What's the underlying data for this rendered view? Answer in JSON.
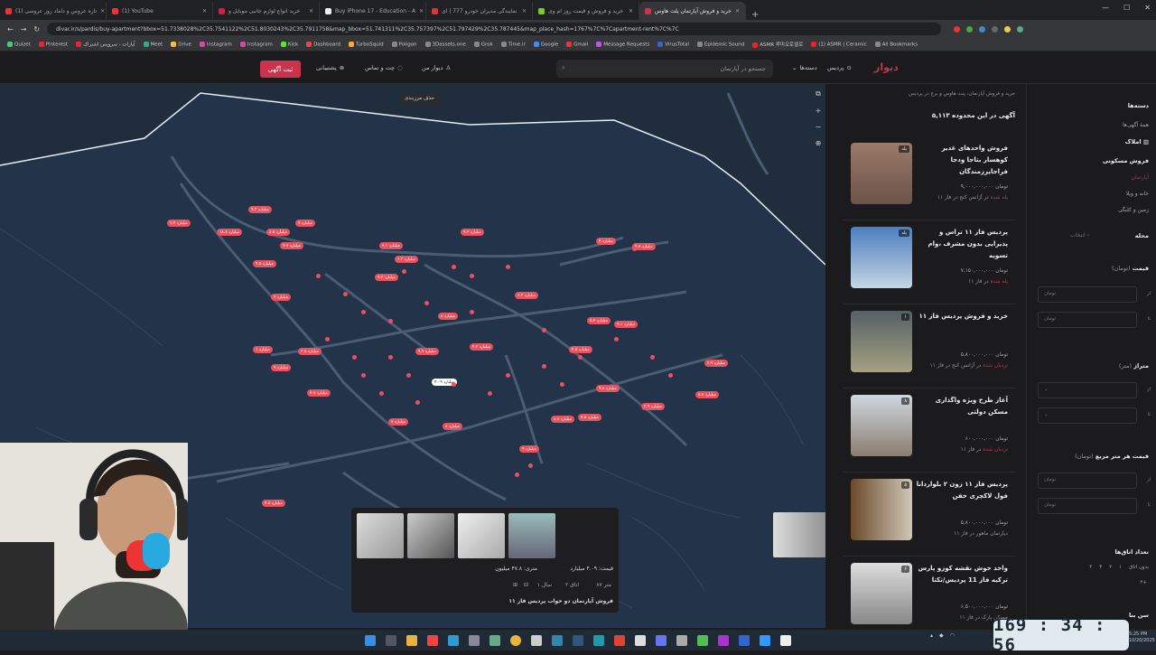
{
  "browser": {
    "tabs": [
      {
        "label": "(1) تاره عروس و داماد روز عروسی"
      },
      {
        "label": "(1) YouTube"
      },
      {
        "label": "خرید انواع لوازم جانبی موبایل و"
      },
      {
        "label": "Buy iPhone 17 - Education - A"
      },
      {
        "label": "نمایندگی مدیران خودرو 777 | ای"
      },
      {
        "label": "خرید و فروش و قیمت روز ام وی"
      },
      {
        "label": "خرید و فروش آپارتمان پلت هاوس"
      }
    ],
    "url": "divar.ir/s/pardis/buy-apartment?bbox=51.7338028%2C35.7541122%2C51.8030243%2C35.7911758&map_bbox=51.741311%2C35.757397%2C51.797429%2C35.787445&map_place_hash=1767%7C%7Capartment-rent%7C%7C",
    "bookmarks": [
      "Quizet",
      "Pinterest",
      "آپارات - سرویس اشتراک",
      "Meet",
      "Drive",
      "Instagram",
      "Instagram",
      "Kick",
      "Dashboard",
      "TurboSquid",
      "Poligon",
      "3Dassets.one",
      "Grok",
      "Time.ir",
      "Google",
      "Gmail",
      "Message Requests",
      "VirusTotal",
      "Epidemic Sound",
      "ASMR 루미오로셀로",
      "(1) ASMR | Ceramic",
      "All Bookmarks"
    ]
  },
  "header": {
    "logo": "دیوار",
    "city": "پردیس",
    "categories": "دسته‌ها",
    "search_placeholder": "جستجو در آپارتمان",
    "my_divar": "دیوار من",
    "chat": "چت و تماس",
    "support": "پشتیبانی",
    "post_button": "ثبت آگهی"
  },
  "map": {
    "tooltip": "حذف مرزبندی",
    "zoom_in": "+",
    "zoom_out": "−",
    "pins": [
      "۹.۴ میلیارد",
      "۱۸.۸ میلیارد",
      "۹.۳ میلیارد",
      "۷ میلیارد",
      "۸.۵ میلیارد",
      "۹.۷ میلیارد",
      "۹.۵ میلیارد",
      "۶.۱ میلیارد",
      "۶.۳ میلیارد",
      "۹.۲ میلیارد",
      "۴ میلیارد",
      "۴.۷ میلیارد",
      "۷ میلیارد",
      "۹.۴ میلیارد",
      "۶.۲ میلیارد",
      "۱ میلیارد",
      "۹ میلیارد",
      "۳.۸ میلیارد",
      "۴.۷ میلیارد",
      "۹.۹ میلیارد",
      "۸ میلیارد",
      "۴.۲ میلیارد",
      "۵.۴ میلیارد",
      "۴.۵ میلیارد",
      "۹.۱ میلیارد",
      "۲.۹ میلیارد",
      "۵.۷ میلیارد",
      "۶.۹ میلیارد",
      "۹.۸ میلیارد",
      "۷.۵ میلیارد",
      "۸.۸ میلیارد",
      "۷ میلیارد",
      "۸ میلیارد",
      "۹ میلیارد",
      "۴.۸ میلیارد"
    ],
    "selected_pin": "۴.۰۹ میلیارد"
  },
  "popup": {
    "price": "قیمت: ۴.۰۹ میلیارد",
    "per_meter": "متری: ۴۷.۸ میلیون",
    "area": "۸۷ متر",
    "rooms": "۲ اتاق",
    "year": "سال ۱",
    "title": "فروش آپارتمان دو خواب پردیس فاز ۱۱"
  },
  "listing": {
    "breadcrumb": "خرید و فروش آپارتمان، پنت هاوس و برج در پردیس",
    "count": "۵,۱۱۳ آگهی در این محدوده",
    "cards": [
      {
        "title": "فروش واحدهای غدیر کوهسار بتاجا ودجا فراجاپرزمندگان",
        "price": "۹,۰۰۰,۰۰۰,۰۰۰ تومان",
        "meta_hl": "پله شده",
        "meta": "در آژانس کنج در فاز ۱۱",
        "badge": "پله"
      },
      {
        "title": "پردیس فاز ۱۱ تراس و پذیرایی بدون مشرف ،وام تسویه",
        "price": "۷,۱۵۰,۰۰۰,۰۰۰ تومان",
        "meta_hl": "پله شده",
        "meta": "در فاز ۱۱",
        "badge": "پله"
      },
      {
        "title": "خرید و فروش پردیس فاز ۱۱",
        "price": "۵,۸۰۰,۰۰۰,۰۰۰ تومان",
        "meta_hl": "نردبان شده",
        "meta": "در آژانس کنج در فاز ۱۱",
        "badge": "۱"
      },
      {
        "title": "آغاز طرح ویژه واگذاری مسکن دولتی",
        "price": "۶۰۰,۰۰۰,۰۰۰ تومان",
        "meta_hl": "نردبان شده",
        "meta": "در فاز ۱۱",
        "badge": "۸"
      },
      {
        "title": "پردیس فاز ۱۱ زون ۲ بلواردانا فول لاکچری خفن",
        "price": "۵,۸۰۰,۰۰۰,۰۰۰ تومان",
        "meta_hl": "",
        "meta": "دیارتمان ماهور در فاز ۱۱",
        "badge": "۵"
      },
      {
        "title": "واحد خوش نقشه کوزو پارس ترکیه فاز 11 پردیس/تکتا",
        "price": "۶,۵۰۰,۰۰۰,۰۰۰ تومان",
        "meta_hl": "",
        "meta": "مسکن پارک در فاز ۱۱",
        "badge": "۶"
      }
    ]
  },
  "filters": {
    "categories_title": "دسته‌ها",
    "all_ads": "همهٔ آگهی‌ها",
    "real_estate": "املاک",
    "residential_sale": "فروش مسکونی",
    "apartment": "آپارتمان",
    "villa": "خانه و ویلا",
    "land": "زمین و کلنگی",
    "neighborhood": "محله",
    "choose": "انتخاب",
    "price": "قیمت",
    "price_unit": "(تومان)",
    "from": "از",
    "to": "تا",
    "toman": "تومان",
    "area": "متراژ",
    "area_unit": "(متر)",
    "price_per_meter": "قیمت هر متر مربع",
    "rooms": "تعداد اتاق‌ها",
    "no_room": "بدون اتاق",
    "room_opts": [
      "۱",
      "۲",
      "۳",
      "۴",
      "۴+"
    ],
    "age": "سن بنا"
  },
  "timer": "169 : 34 : 56",
  "clock": {
    "time": "5:25 PM",
    "date": "10/20/2025"
  }
}
